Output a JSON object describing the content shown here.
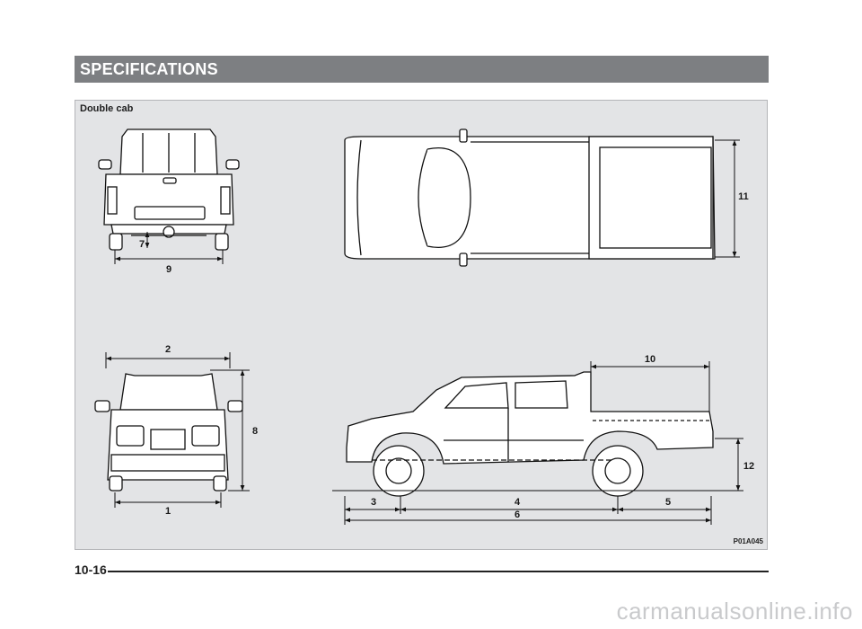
{
  "header": {
    "title": "SPECIFICATIONS"
  },
  "figure": {
    "variant_label": "Double cab",
    "figure_id": "P01A045",
    "dimension_labels": {
      "d1": "1",
      "d2": "2",
      "d3": "3",
      "d4": "4",
      "d5": "5",
      "d6": "6",
      "d7": "7",
      "d8": "8",
      "d9": "9",
      "d10": "10",
      "d11": "11",
      "d12": "12"
    }
  },
  "footer": {
    "page_number": "10-16"
  },
  "watermark": "carmanualsonline.info"
}
